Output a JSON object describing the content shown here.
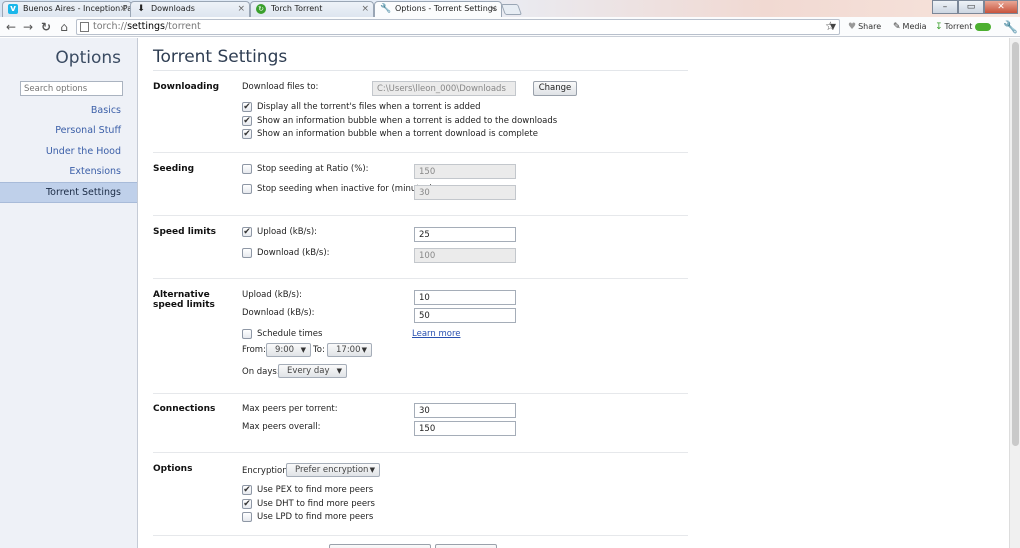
{
  "tabs": [
    {
      "title": "Buenos Aires - Inception Pa",
      "icon": "vimeo-icon"
    },
    {
      "title": "Downloads",
      "icon": "download-icon"
    },
    {
      "title": "Torch Torrent",
      "icon": "torch-icon"
    },
    {
      "title": "Options - Torrent Settings",
      "icon": "wrench-icon"
    }
  ],
  "address": {
    "scheme": "torch://",
    "path": "settings",
    "rest": "/torrent"
  },
  "toolbar": {
    "share": "Share",
    "media": "Media",
    "torrent": "Torrent"
  },
  "sidebar": {
    "title": "Options",
    "search_placeholder": "Search options",
    "items": [
      "Basics",
      "Personal Stuff",
      "Under the Hood",
      "Extensions",
      "Torrent Settings"
    ]
  },
  "page": {
    "title": "Torrent Settings",
    "downloading": {
      "header": "Downloading",
      "label": "Download files to:",
      "path": "C:\\Users\\lleon_000\\Downloads",
      "change": "Change",
      "options": [
        "Display all the torrent's files when a torrent is added",
        "Show an information bubble when a torrent is added to the downloads",
        "Show an information bubble when a torrent download is complete"
      ]
    },
    "seeding": {
      "header": "Seeding",
      "ratio_label": "Stop seeding at Ratio (%):",
      "ratio_value": "150",
      "inactive_label": "Stop seeding when inactive for (minutes):",
      "inactive_value": "30"
    },
    "speed": {
      "header": "Speed limits",
      "upload_label": "Upload (kB/s):",
      "upload_value": "25",
      "download_label": "Download (kB/s):",
      "download_value": "100"
    },
    "alt": {
      "header": "Alternative speed limits",
      "upload_label": "Upload (kB/s):",
      "upload_value": "10",
      "download_label": "Download (kB/s):",
      "download_value": "50",
      "schedule_label": "Schedule times",
      "learn_more": "Learn more",
      "from_label": "From:",
      "from_value": "9:00",
      "to_label": "To:",
      "to_value": "17:00",
      "days_label": "On days:",
      "days_value": "Every day"
    },
    "connections": {
      "header": "Connections",
      "per_torrent_label": "Max peers per torrent:",
      "per_torrent_value": "30",
      "overall_label": "Max peers overall:",
      "overall_value": "150"
    },
    "options": {
      "header": "Options",
      "encryption_label": "Encryption:",
      "encryption_value": "Prefer encryption",
      "pex": "Use PEX to find more peers",
      "dht": "Use DHT to find more peers",
      "lpd": "Use LPD to find more peers"
    }
  }
}
